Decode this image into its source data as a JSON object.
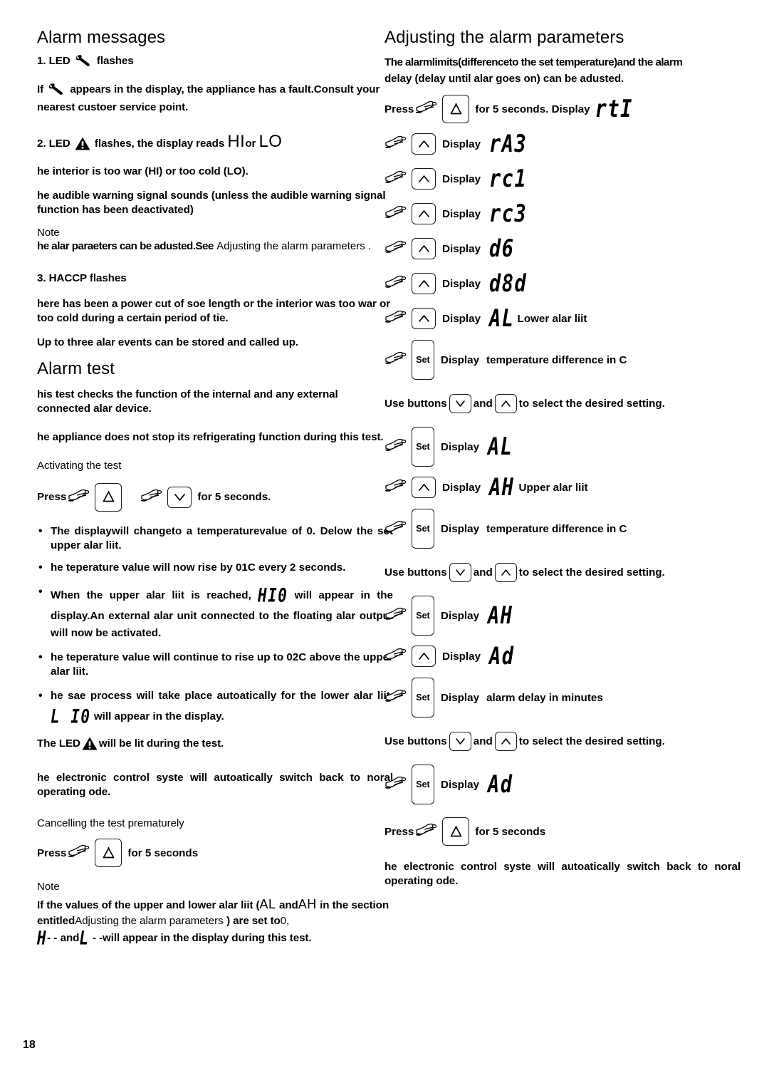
{
  "page": {
    "number": "18"
  },
  "left": {
    "heading_alarm_messages": "Alarm messages",
    "item1": {
      "title_pre": "1. LED",
      "title_post": "flashes",
      "body_pre": "If",
      "body_post": "appears in the display, the appliance has a fault.Consult your nearest custoer service point."
    },
    "item2": {
      "title_pre": "2. LED",
      "title_mid": "flashes, the display reads",
      "lcd_hi": "HI",
      "title_or": "or",
      "lcd_lo": "LO",
      "line1": "he interior is too war (HI) or too cold (LO).",
      "line2": "he audible warning signal sounds (unless the audible warning signal function has been deactivated)",
      "note_label": "Note",
      "note_bold": "he alar paraeters can be adusted.See",
      "note_regular": "Adjusting the alarm parameters .",
      "note_regular2": "parameters ."
    },
    "item3": {
      "title": "3. HACCP flashes",
      "line1": "here has been a power cut of soe length or the interior was too war or too cold during a certain period of tie.",
      "line2": "Up to three alar events can be stored and called up."
    },
    "heading_alarm_test": "Alarm test",
    "test": {
      "p1": "his test checks the function of the internal and any external connected alar device.",
      "p2": "he appliance does not stop its refrigerating function during this test.",
      "activating_label": "Activating the test",
      "press_label": "Press",
      "press_suffix": "for 5 seconds.",
      "bullets": [
        "The displaywill changeto a temperaturevalue of 0.      Delow the set upper alar liit.",
        "he teperature value will now rise by 01C every 2 seconds.",
        "When the upper alar liit is reached,  HI0  will appear in the display.An external alar unit connected to the floating alar output will now be activated.",
        "he teperature value will continue to rise up to 02C above the upper alar liit.",
        "he sae process will take place autoatically for the lower alar liit.   L I0  will appear in the display."
      ],
      "bullet3_pre": "When the upper alar liit is reached,",
      "bullet3_lcd": "HI0",
      "bullet3_post": "will appear in the display.An external alar unit connected to the floating alar output will now be activated.",
      "bullet5_pre": "he sae process will take place autoatically for the lower alar liit.",
      "bullet5_lcd": "L I0",
      "bullet5_post": "will appear in the display.",
      "led_pre": "The LED",
      "led_post": "will be lit during the test.",
      "switchback": "he electronic control syste will autoatically switch back to noral operating ode.",
      "cancel_label": "Cancelling the test prematurely",
      "cancel_press": "Press",
      "cancel_suffix": "for 5 seconds",
      "note_label": "Note",
      "note_l1a": "If the values of the upper and lower alar liit (",
      "note_l1b": "AL",
      "note_l1c": "and",
      "note_l1d": "AH",
      "note_l1e": "in the",
      "note_l2a": "section entitled",
      "note_l2b": "Adjusting the alarm parameters",
      "note_l2c": ") are set to",
      "note_l2d": "0,",
      "note_l3a": "H",
      "note_l3b": "- -",
      "note_l3c": "and",
      "note_l3d": "L",
      "note_l3e": "- -",
      "note_l3f": "will appear in the display during this test."
    }
  },
  "right": {
    "heading": "Adjusting the alarm parameters",
    "intro_l1": "The alarmlimits(differenceto the set temperature)and the alarm",
    "intro_l2": "delay (delay until alar goes on) can be adusted.",
    "steps": [
      {
        "lead": "Press",
        "key": "bell",
        "after": "for 5 seconds. Display",
        "lcd": "rtI",
        "tail": ""
      },
      {
        "lead": "",
        "key": "up",
        "after": "Display",
        "lcd": "rA3",
        "tail": ""
      },
      {
        "lead": "",
        "key": "up",
        "after": "Display",
        "lcd": "rc1",
        "tail": ""
      },
      {
        "lead": "",
        "key": "up",
        "after": "Display",
        "lcd": "rc3",
        "tail": ""
      },
      {
        "lead": "",
        "key": "up",
        "after": "Display",
        "lcd": "d6",
        "tail": ""
      },
      {
        "lead": "",
        "key": "up",
        "after": "Display",
        "lcd": "d8d",
        "tail": ""
      },
      {
        "lead": "",
        "key": "up",
        "after": "Display",
        "lcd": "AL",
        "tail": "Lower alar liit"
      },
      {
        "lead": "",
        "key": "set",
        "after": "Display",
        "lcd": "",
        "tail": "temperature difference in     C"
      }
    ],
    "use_buttons_pre": "Use buttons",
    "use_buttons_mid": "and",
    "use_buttons_post": "to select the desired setting.",
    "steps2": [
      {
        "lead": "",
        "key": "set",
        "after": "Display",
        "lcd": "AL",
        "tail": ""
      },
      {
        "lead": "",
        "key": "up",
        "after": "Display",
        "lcd": "AH",
        "tail": "Upper alar liit"
      },
      {
        "lead": "",
        "key": "set",
        "after": "Display",
        "lcd": "",
        "tail": "temperature difference in     C"
      }
    ],
    "steps3": [
      {
        "lead": "",
        "key": "set",
        "after": "Display",
        "lcd": "AH",
        "tail": ""
      },
      {
        "lead": "",
        "key": "up",
        "after": "Display",
        "lcd": "Ad",
        "tail": ""
      },
      {
        "lead": "",
        "key": "set",
        "after": "Display",
        "lcd": "",
        "tail": "alarm delay in minutes"
      }
    ],
    "steps4": [
      {
        "lead": "",
        "key": "set",
        "after": "Display",
        "lcd": "Ad",
        "tail": ""
      }
    ],
    "press_label": "Press",
    "press_suffix": "for 5 seconds",
    "closing": "he electronic control syste will autoatically switch back to noral operating ode.",
    "set_key_label": "Set"
  },
  "colors": {
    "ink": "#000000",
    "key_outline": "#1a1a1a",
    "paper": "#ffffff"
  }
}
